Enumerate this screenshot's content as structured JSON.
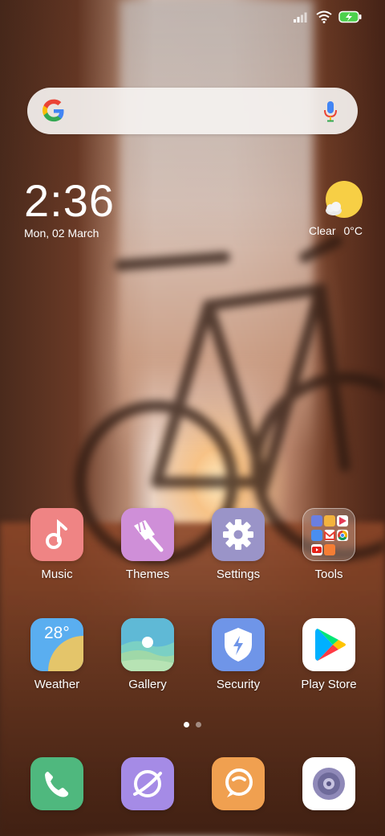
{
  "status_bar": {
    "icons": [
      "signal-icon",
      "wifi-icon",
      "battery-charging-icon"
    ]
  },
  "search": {
    "logo": "google-g-icon",
    "mic": "microphone-icon"
  },
  "clock": {
    "time": "2:36",
    "date": "Mon, 02 March"
  },
  "weather": {
    "condition": "Clear",
    "temperature": "0°C",
    "icon": "sunny-cloud-icon"
  },
  "apps_row1": [
    {
      "label": "Music",
      "icon": "music-note-icon"
    },
    {
      "label": "Themes",
      "icon": "paintbrush-icon"
    },
    {
      "label": "Settings",
      "icon": "gear-icon"
    },
    {
      "label": "Tools",
      "icon": "folder-icon"
    }
  ],
  "apps_row2": [
    {
      "label": "Weather",
      "icon": "weather-icon",
      "temp": "28°"
    },
    {
      "label": "Gallery",
      "icon": "gallery-icon"
    },
    {
      "label": "Security",
      "icon": "shield-icon"
    },
    {
      "label": "Play Store",
      "icon": "play-store-icon"
    }
  ],
  "page_indicator": {
    "pages": 2,
    "current": 1
  },
  "dock": [
    {
      "name": "phone",
      "icon": "phone-icon"
    },
    {
      "name": "browser",
      "icon": "browser-icon"
    },
    {
      "name": "messaging",
      "icon": "message-icon"
    },
    {
      "name": "camera",
      "icon": "camera-icon"
    }
  ],
  "colors": {
    "music": "#ef8484",
    "themes": "#cf8fd8",
    "settings": "#9a94c8",
    "weather_sky": "#5aaef0",
    "weather_sun": "#e4c56a",
    "security": "#6f95e8",
    "phone": "#4fb87e",
    "browser": "#a58be6",
    "messaging": "#f0a050",
    "camera_bg": "#ffffff"
  }
}
